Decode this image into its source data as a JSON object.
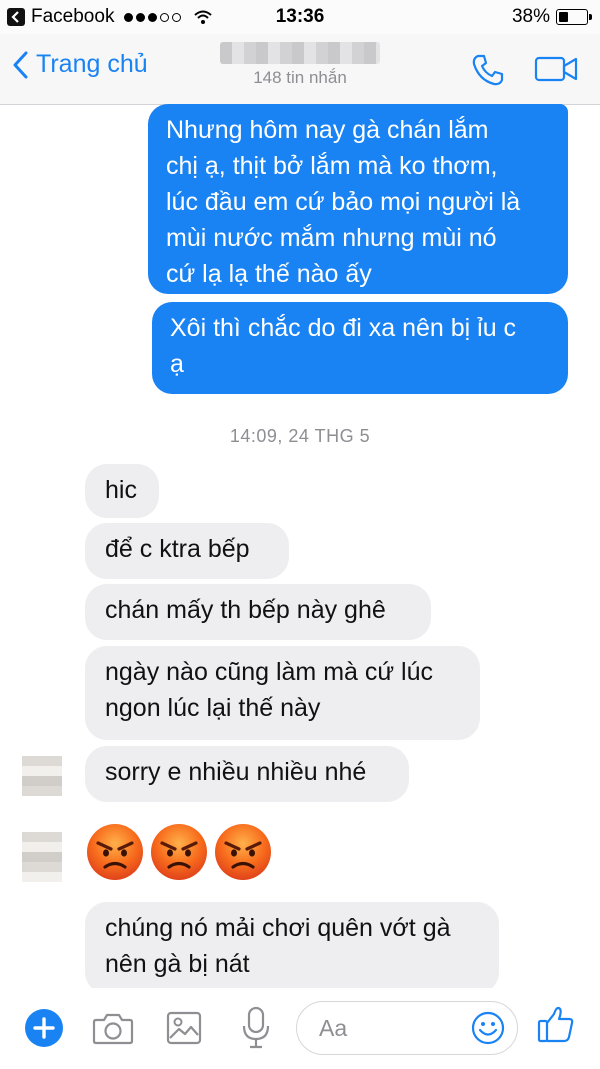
{
  "status_bar": {
    "app": "Facebook",
    "time": "13:36",
    "battery_text": "38%",
    "battery_level": 0.38
  },
  "header": {
    "back_label": "Trang chủ",
    "message_count": "148 tin nhắn"
  },
  "messages_out": [
    {
      "text": "Nhưng hôm nay gà chán lắm\nchị ạ, thịt bở lắm mà ko thơm,\nlúc đầu em cứ bảo mọi người là\nmùi nước mắm nhưng mùi nó\ncứ lạ lạ thế nào ấy"
    },
    {
      "text": "Xôi thì chắc do đi xa nên bị ỉu c\nạ"
    }
  ],
  "timestamp": "14:09, 24 THG 5",
  "messages_in": [
    {
      "text": "hic"
    },
    {
      "text": "để c ktra bếp"
    },
    {
      "text": "chán mấy th bếp này ghê"
    },
    {
      "text": "ngày nào cũng làm mà cứ lúc\nngon lúc lại thế này"
    },
    {
      "text": "sorry e nhiều nhiều nhé"
    },
    {
      "text": "chúng nó mải chơi quên vớt gà\nnên gà bị nát"
    }
  ],
  "emoji_message": {
    "icon": "angry-face-emoji",
    "count": 3
  },
  "composer": {
    "placeholder": "Aa",
    "icons": [
      "plus-icon",
      "camera-icon",
      "photo-icon",
      "microphone-icon",
      "smiley-icon",
      "thumbs-up-icon"
    ]
  },
  "colors": {
    "accent": "#1a83f4",
    "incoming_bubble": "#eeeef0",
    "muted_text": "#8e8e93"
  }
}
